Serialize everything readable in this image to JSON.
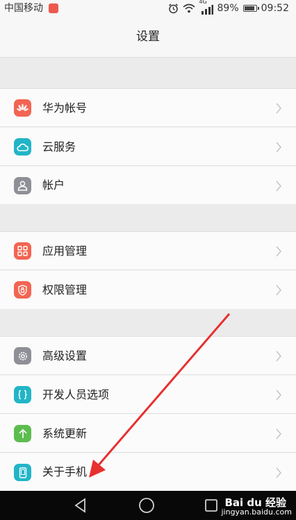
{
  "status_bar": {
    "carrier": "中国移动",
    "network": "4G",
    "battery": "89%",
    "time": "09:52"
  },
  "header": {
    "title": "设置"
  },
  "groups": [
    {
      "items": [
        {
          "label": "华为帐号",
          "icon": "huawei-icon",
          "color": "#f26552"
        },
        {
          "label": "云服务",
          "icon": "cloud-icon",
          "color": "#22b5c7"
        },
        {
          "label": "帐户",
          "icon": "person-icon",
          "color": "#8f8f97"
        }
      ]
    },
    {
      "items": [
        {
          "label": "应用管理",
          "icon": "apps-grid-icon",
          "color": "#f26552"
        },
        {
          "label": "权限管理",
          "icon": "shield-icon",
          "color": "#f26552"
        }
      ]
    },
    {
      "items": [
        {
          "label": "高级设置",
          "icon": "gear-icon",
          "color": "#8f8f97"
        },
        {
          "label": "开发人员选项",
          "icon": "braces-icon",
          "color": "#22b5c7"
        },
        {
          "label": "系统更新",
          "icon": "arrow-up-icon",
          "color": "#5cbd4e"
        },
        {
          "label": "关于手机",
          "icon": "phone-icon",
          "color": "#22b5c7"
        }
      ]
    }
  ],
  "watermark": {
    "brand": "Bai du 经验",
    "url": "jingyan.baidu.com"
  },
  "colors": {
    "annotation_arrow": "#e8302f"
  }
}
